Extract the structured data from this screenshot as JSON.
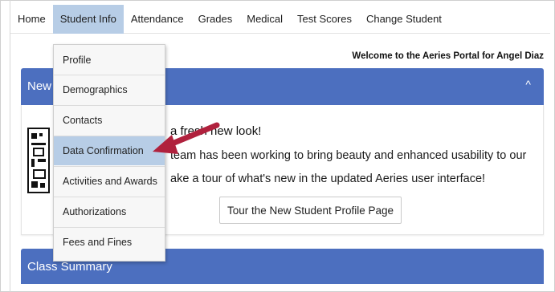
{
  "nav": {
    "items": [
      {
        "label": "Home",
        "active": false
      },
      {
        "label": "Student Info",
        "active": true
      },
      {
        "label": "Attendance",
        "active": false
      },
      {
        "label": "Grades",
        "active": false
      },
      {
        "label": "Medical",
        "active": false
      },
      {
        "label": "Test Scores",
        "active": false
      },
      {
        "label": "Change Student",
        "active": false
      }
    ]
  },
  "welcome": "Welcome to the Aeries Portal for Angel Diaz",
  "news": {
    "title_visible": "New",
    "collapse_icon": "chevron-up-icon",
    "headline_visible": "a fresh new look!",
    "line1_visible": "team has been working to bring beauty and enhanced usability to our",
    "line2_visible": "ake a tour of what's new in the updated Aeries user interface!",
    "button_label": "Tour the New Student Profile Page"
  },
  "class_summary": {
    "title": "Class Summary"
  },
  "dropdown": {
    "items": [
      {
        "label": "Profile",
        "highlighted": false
      },
      {
        "label": "Demographics",
        "highlighted": false
      },
      {
        "label": "Contacts",
        "highlighted": false
      },
      {
        "label": "Data Confirmation",
        "highlighted": true
      },
      {
        "label": "Activities and Awards",
        "highlighted": false
      },
      {
        "label": "Authorizations",
        "highlighted": false
      },
      {
        "label": "Fees and Fines",
        "highlighted": false
      }
    ]
  },
  "colors": {
    "header_blue": "#4c6fbf",
    "highlight_blue": "#b7cde6",
    "arrow_red": "#b0213d"
  }
}
